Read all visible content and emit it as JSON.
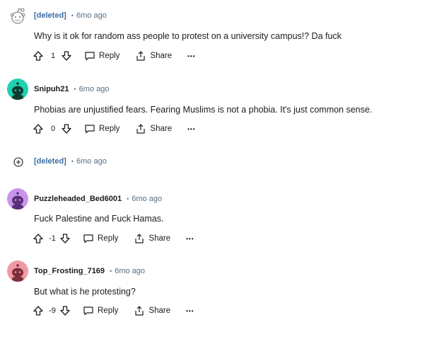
{
  "colors": {
    "deleted_author": "#3a6ea5",
    "meta": "#576f82",
    "text": "#1c1c1c",
    "avatar_teal": "#1ed1b0",
    "avatar_purple": "#c995e6",
    "avatar_pink": "#f09aa4"
  },
  "comments": [
    {
      "author": "[deleted]",
      "sep": "•",
      "time": "6mo ago",
      "body": "Why is it ok for random ass people to protest on a university campus!? Da fuck",
      "score": "1",
      "reply": "Reply",
      "share": "Share",
      "more": "•••"
    },
    {
      "author": "Snipuh21",
      "sep": "•",
      "time": "6mo ago",
      "body": "Phobias are unjustified fears. Fearing Muslims is not a phobia. It's just common sense.",
      "score": "0",
      "reply": "Reply",
      "share": "Share",
      "more": "•••"
    },
    {
      "author": "[deleted]",
      "sep": "•",
      "time": "6mo ago"
    },
    {
      "author": "Puzzleheaded_Bed6001",
      "sep": "•",
      "time": "6mo ago",
      "body": "Fuck Palestine and Fuck Hamas.",
      "score": "-1",
      "reply": "Reply",
      "share": "Share",
      "more": "•••"
    },
    {
      "author": "Top_Frosting_7169",
      "sep": "•",
      "time": "6mo ago",
      "body": "But what is he protesting?",
      "score": "-9",
      "reply": "Reply",
      "share": "Share",
      "more": "•••"
    }
  ]
}
